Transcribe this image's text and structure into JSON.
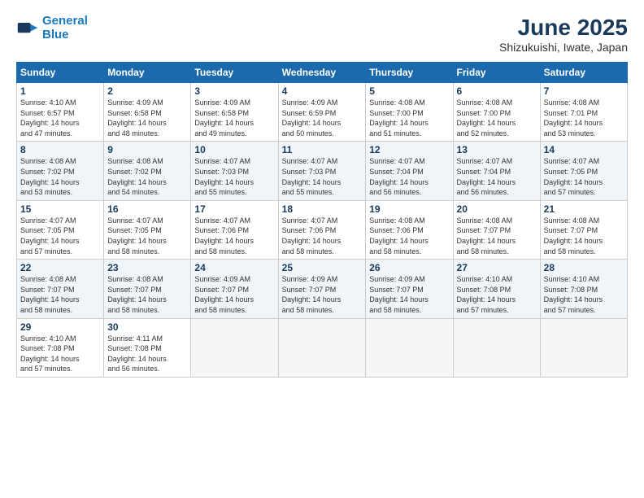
{
  "logo": {
    "line1": "General",
    "line2": "Blue"
  },
  "title": "June 2025",
  "subtitle": "Shizukuishi, Iwate, Japan",
  "days_of_week": [
    "Sunday",
    "Monday",
    "Tuesday",
    "Wednesday",
    "Thursday",
    "Friday",
    "Saturday"
  ],
  "weeks": [
    [
      {
        "day": "1",
        "sunrise": "4:10 AM",
        "sunset": "6:57 PM",
        "daylight": "14 hours and 47 minutes."
      },
      {
        "day": "2",
        "sunrise": "4:09 AM",
        "sunset": "6:58 PM",
        "daylight": "14 hours and 48 minutes."
      },
      {
        "day": "3",
        "sunrise": "4:09 AM",
        "sunset": "6:58 PM",
        "daylight": "14 hours and 49 minutes."
      },
      {
        "day": "4",
        "sunrise": "4:09 AM",
        "sunset": "6:59 PM",
        "daylight": "14 hours and 50 minutes."
      },
      {
        "day": "5",
        "sunrise": "4:08 AM",
        "sunset": "7:00 PM",
        "daylight": "14 hours and 51 minutes."
      },
      {
        "day": "6",
        "sunrise": "4:08 AM",
        "sunset": "7:00 PM",
        "daylight": "14 hours and 52 minutes."
      },
      {
        "day": "7",
        "sunrise": "4:08 AM",
        "sunset": "7:01 PM",
        "daylight": "14 hours and 53 minutes."
      }
    ],
    [
      {
        "day": "8",
        "sunrise": "4:08 AM",
        "sunset": "7:02 PM",
        "daylight": "14 hours and 53 minutes."
      },
      {
        "day": "9",
        "sunrise": "4:08 AM",
        "sunset": "7:02 PM",
        "daylight": "14 hours and 54 minutes."
      },
      {
        "day": "10",
        "sunrise": "4:07 AM",
        "sunset": "7:03 PM",
        "daylight": "14 hours and 55 minutes."
      },
      {
        "day": "11",
        "sunrise": "4:07 AM",
        "sunset": "7:03 PM",
        "daylight": "14 hours and 55 minutes."
      },
      {
        "day": "12",
        "sunrise": "4:07 AM",
        "sunset": "7:04 PM",
        "daylight": "14 hours and 56 minutes."
      },
      {
        "day": "13",
        "sunrise": "4:07 AM",
        "sunset": "7:04 PM",
        "daylight": "14 hours and 56 minutes."
      },
      {
        "day": "14",
        "sunrise": "4:07 AM",
        "sunset": "7:05 PM",
        "daylight": "14 hours and 57 minutes."
      }
    ],
    [
      {
        "day": "15",
        "sunrise": "4:07 AM",
        "sunset": "7:05 PM",
        "daylight": "14 hours and 57 minutes."
      },
      {
        "day": "16",
        "sunrise": "4:07 AM",
        "sunset": "7:05 PM",
        "daylight": "14 hours and 58 minutes."
      },
      {
        "day": "17",
        "sunrise": "4:07 AM",
        "sunset": "7:06 PM",
        "daylight": "14 hours and 58 minutes."
      },
      {
        "day": "18",
        "sunrise": "4:07 AM",
        "sunset": "7:06 PM",
        "daylight": "14 hours and 58 minutes."
      },
      {
        "day": "19",
        "sunrise": "4:08 AM",
        "sunset": "7:06 PM",
        "daylight": "14 hours and 58 minutes."
      },
      {
        "day": "20",
        "sunrise": "4:08 AM",
        "sunset": "7:07 PM",
        "daylight": "14 hours and 58 minutes."
      },
      {
        "day": "21",
        "sunrise": "4:08 AM",
        "sunset": "7:07 PM",
        "daylight": "14 hours and 58 minutes."
      }
    ],
    [
      {
        "day": "22",
        "sunrise": "4:08 AM",
        "sunset": "7:07 PM",
        "daylight": "14 hours and 58 minutes."
      },
      {
        "day": "23",
        "sunrise": "4:08 AM",
        "sunset": "7:07 PM",
        "daylight": "14 hours and 58 minutes."
      },
      {
        "day": "24",
        "sunrise": "4:09 AM",
        "sunset": "7:07 PM",
        "daylight": "14 hours and 58 minutes."
      },
      {
        "day": "25",
        "sunrise": "4:09 AM",
        "sunset": "7:07 PM",
        "daylight": "14 hours and 58 minutes."
      },
      {
        "day": "26",
        "sunrise": "4:09 AM",
        "sunset": "7:07 PM",
        "daylight": "14 hours and 58 minutes."
      },
      {
        "day": "27",
        "sunrise": "4:10 AM",
        "sunset": "7:08 PM",
        "daylight": "14 hours and 57 minutes."
      },
      {
        "day": "28",
        "sunrise": "4:10 AM",
        "sunset": "7:08 PM",
        "daylight": "14 hours and 57 minutes."
      }
    ],
    [
      {
        "day": "29",
        "sunrise": "4:10 AM",
        "sunset": "7:08 PM",
        "daylight": "14 hours and 57 minutes."
      },
      {
        "day": "30",
        "sunrise": "4:11 AM",
        "sunset": "7:08 PM",
        "daylight": "14 hours and 56 minutes."
      },
      null,
      null,
      null,
      null,
      null
    ]
  ]
}
